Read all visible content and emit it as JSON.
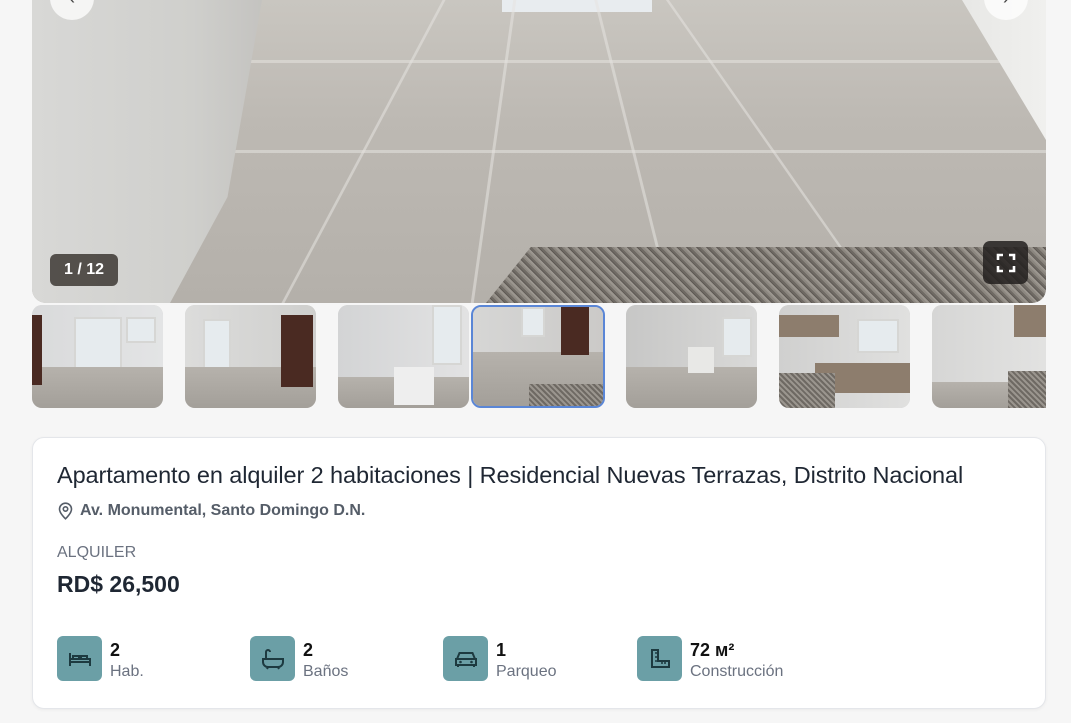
{
  "gallery": {
    "counter": "1 / 12",
    "thumbnail_count_visible": 7,
    "active_thumbnail": 4
  },
  "listing": {
    "title": "Apartamento en alquiler 2 habitaciones | Residencial Nuevas Terrazas, Distrito Nacional",
    "address": "Av. Monumental, Santo Domingo D.N.",
    "operation": "ALQUILER",
    "price": "RD$ 26,500"
  },
  "features": [
    {
      "icon": "bed-icon",
      "value": "2",
      "label": "Hab."
    },
    {
      "icon": "bathtub-icon",
      "value": "2",
      "label": "Baños"
    },
    {
      "icon": "car-icon",
      "value": "1",
      "label": "Parqueo"
    },
    {
      "icon": "area-ruler-icon",
      "value": "72 ᴍ²",
      "label": "Construcción"
    }
  ],
  "colors": {
    "accent": "#6b9fa6",
    "active_border": "#5a86d6",
    "text_primary": "#1f2733",
    "text_muted": "#6b7280"
  }
}
